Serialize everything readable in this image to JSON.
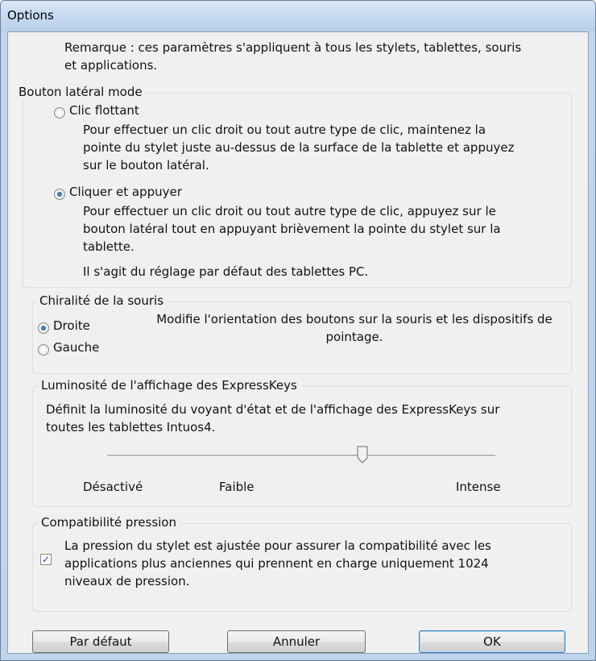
{
  "window": {
    "title": "Options"
  },
  "note": {
    "line1": "Remarque : ces paramètres s'appliquent à tous les stylets, tablettes, souris",
    "line2": "et applications."
  },
  "side_button": {
    "legend": "Bouton latéral mode",
    "options": [
      {
        "label": "Clic flottant",
        "checked": false,
        "desc": [
          "Pour effectuer un clic droit ou tout autre type de clic, maintenez la",
          "pointe du stylet juste au-dessus de la surface de la tablette et appuyez",
          "sur le bouton latéral."
        ]
      },
      {
        "label": "Cliquer et appuyer",
        "checked": true,
        "desc": [
          "Pour effectuer un clic droit ou tout autre type de clic, appuyez sur le",
          "bouton latéral tout en appuyant brièvement la pointe du stylet sur la",
          "tablette."
        ]
      }
    ],
    "default_note": "Il s'agit du réglage par défaut des tablettes PC."
  },
  "handedness": {
    "legend": "Chiralité de la souris",
    "options": [
      {
        "label": "Droite",
        "checked": true
      },
      {
        "label": "Gauche",
        "checked": false
      }
    ],
    "desc_line1": "Modifie l'orientation des boutons sur la souris et les dispositifs de",
    "desc_line2": "pointage."
  },
  "brightness": {
    "legend": "Luminosité de l'affichage des ExpressKeys",
    "desc_line1": "Définit la luminosité du voyant d'état et de l'affichage des ExpressKeys sur",
    "desc_line2": "toutes les tablettes Intuos4.",
    "labels": [
      "Désactivé",
      "Faible",
      "Intense"
    ],
    "slider_value_percent": 66
  },
  "pressure": {
    "legend": "Compatibilité pression",
    "checked": true,
    "line1": "La pression du stylet est ajustée pour assurer la compatibilité avec les",
    "line2": "applications plus anciennes qui prennent en charge uniquement 1024",
    "line3": "niveaux de pression."
  },
  "buttons": {
    "default": "Par défaut",
    "cancel": "Annuler",
    "ok": "OK"
  }
}
